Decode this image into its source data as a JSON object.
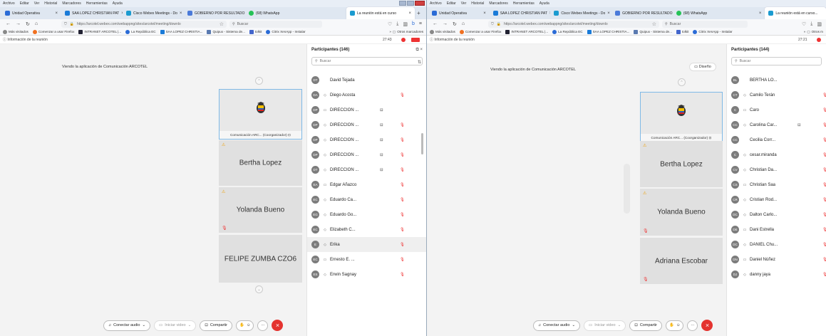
{
  "menu": [
    "Archivo",
    "Editar",
    "Ver",
    "Historial",
    "Marcadores",
    "Herramientas",
    "Ayuda"
  ],
  "left": {
    "tabs": [
      {
        "label": "Unidad Operativa",
        "color": "#2a6bd6"
      },
      {
        "label": "SAA LOPEZ CHRISTIAN PAT",
        "color": "#1a7bd8"
      },
      {
        "label": "Cisco Webex Meetings - Do",
        "color": "#1b9bd0"
      },
      {
        "label": "GOBIERNO POR RESULTADO",
        "color": "#4a7ad9"
      },
      {
        "label": "(68) WhatsApp",
        "color": "#25c257"
      },
      {
        "label": "La reunión está en curso",
        "color": "#1b9bd0"
      }
    ],
    "url": "https://arcotel.webex.com/webappng/sites/arcotel/meeting/downlo",
    "search": "Buscar",
    "bookmarks": [
      "Más visitados",
      "Comenzar a usar Firefox",
      "INTRANET ARCOTEL |...",
      "La República EC",
      "SAA LOPEZ CHRISTIA...",
      "Quipux - Sistema de...",
      "tolkit",
      "Citrix XenApp - Instalar"
    ],
    "other_bookmarks": "Otros marcadores",
    "info": "Información de la reunión",
    "timer": "27:43",
    "viewing": "Viendo la aplicación de Comunicación ARCOTEL",
    "logo_caption": "Comunicación ARC... (Coorganizador)",
    "tiles": [
      "Bertha Lopez",
      "Yolanda Bueno",
      "FELIPE ZUMBA CZO6"
    ],
    "participants_title": "Participantes (146)",
    "search_placeholder": "Buscar",
    "participants": [
      {
        "i": "DT",
        "n": "David Tejada",
        "dev": "",
        "share": false,
        "mic": false
      },
      {
        "i": "DA",
        "n": "Diego Acosta",
        "dev": "◇",
        "share": false,
        "mic": true
      },
      {
        "i": "DP",
        "n": "DIRECCION ...",
        "dev": "▭",
        "share": true,
        "mic": false
      },
      {
        "i": "DP",
        "n": "DIRECCION ...",
        "dev": "◇",
        "share": true,
        "mic": true
      },
      {
        "i": "DP",
        "n": "DIRECCION ...",
        "dev": "◇",
        "share": true,
        "mic": true
      },
      {
        "i": "DP",
        "n": "DIRECCION ...",
        "dev": "◇",
        "share": true,
        "mic": true
      },
      {
        "i": "DT",
        "n": "DIRECCION ...",
        "dev": "◇",
        "share": true,
        "mic": true
      },
      {
        "i": "EA",
        "n": "Edgar Añazco",
        "dev": "▭",
        "share": false,
        "mic": true
      },
      {
        "i": "EC",
        "n": "Eduardo Ca...",
        "dev": "◇",
        "share": false,
        "mic": true
      },
      {
        "i": "EG",
        "n": "Eduardo Go...",
        "dev": "◇",
        "share": false,
        "mic": true
      },
      {
        "i": "EC",
        "n": "Elizabeth C...",
        "dev": "◇",
        "share": false,
        "mic": true
      },
      {
        "i": "E",
        "n": "Erika",
        "dev": "◇",
        "share": false,
        "mic": true
      },
      {
        "i": "EC",
        "n": "Ernesto E. ...",
        "dev": "▭",
        "share": false,
        "mic": true
      },
      {
        "i": "ES",
        "n": "Erwin Sagnay",
        "dev": "◇",
        "share": false,
        "mic": true
      }
    ],
    "toolbar": {
      "audio": "Conectar audio",
      "video": "Iniciar video",
      "share": "Compartir"
    }
  },
  "right": {
    "tabs": [
      {
        "label": "Unidad Operativa",
        "color": "#2a6bd6"
      },
      {
        "label": "SAA LOPEZ CHRISTIAN PAT",
        "color": "#1a7bd8"
      },
      {
        "label": "Cisco Webex Meetings - Do",
        "color": "#1b9bd0"
      },
      {
        "label": "GOBIERNO POR RESULTADO",
        "color": "#4a7ad9"
      },
      {
        "label": "(68) WhatsApp",
        "color": "#25c257"
      },
      {
        "label": "La reunión está en curso...",
        "color": "#1b9bd0"
      }
    ],
    "url": "https://arcotel.webex.com/webappng/sites/arcotel/meeting/downlo",
    "search": "Buscar",
    "bookmarks": [
      "Más visitados",
      "Comenzar a usar Firefox",
      "INTRANET ARCOTEL |...",
      "La República EC",
      "SAA LOPEZ CHRISTIA...",
      "Quipux - Sistema de...",
      "tolkit",
      "Citrix XenApp - Instalar"
    ],
    "other_bookmarks": "Otros m",
    "info": "Información de la reunión",
    "timer": "27:21",
    "viewing": "Viendo la aplicación de Comunicación ARCOTEL",
    "layout": "Diseño",
    "logo_caption": "Comunicación ARC... (Coorganizador)",
    "tiles": [
      "Bertha Lopez",
      "Yolanda Bueno",
      "Adriana Escobar"
    ],
    "participants_title": "Participantes (144)",
    "search_placeholder": "Buscar",
    "participants": [
      {
        "i": "BL",
        "n": "BERTHA LO...",
        "dev": "",
        "share": false,
        "mic": false
      },
      {
        "i": "CT",
        "n": "Camilo Terán",
        "dev": "◇",
        "share": false,
        "mic": true
      },
      {
        "i": "C",
        "n": "Caro",
        "dev": "▭",
        "share": false,
        "mic": true
      },
      {
        "i": "CC",
        "n": "Carolina Car...",
        "dev": "◇",
        "share": true,
        "mic": true
      },
      {
        "i": "CC",
        "n": "Cecilia Corr...",
        "dev": "",
        "share": false,
        "mic": true
      },
      {
        "i": "C",
        "n": "cesar.miranda",
        "dev": "◇",
        "share": false,
        "mic": true
      },
      {
        "i": "CV",
        "n": "Christian Da...",
        "dev": "◇",
        "share": false,
        "mic": true
      },
      {
        "i": "CS",
        "n": "Christian Saa",
        "dev": "▭",
        "share": false,
        "mic": true
      },
      {
        "i": "CR",
        "n": "Cristian Rod...",
        "dev": "◇",
        "share": false,
        "mic": true
      },
      {
        "i": "DC",
        "n": "Dalton Carlo...",
        "dev": "◇",
        "share": false,
        "mic": true
      },
      {
        "i": "DE",
        "n": "Dani Estrella",
        "dev": "▭",
        "share": false,
        "mic": true
      },
      {
        "i": "DC",
        "n": "DANIEL Chu...",
        "dev": "◇",
        "share": false,
        "mic": true
      },
      {
        "i": "DN",
        "n": "Daniel Núñez",
        "dev": "▭",
        "share": false,
        "mic": true
      },
      {
        "i": "DJ",
        "n": "danny jaya",
        "dev": "◇",
        "share": false,
        "mic": true
      }
    ],
    "toolbar": {
      "audio": "Conectar audio",
      "video": "Iniciar video",
      "share": "Compartir"
    }
  }
}
